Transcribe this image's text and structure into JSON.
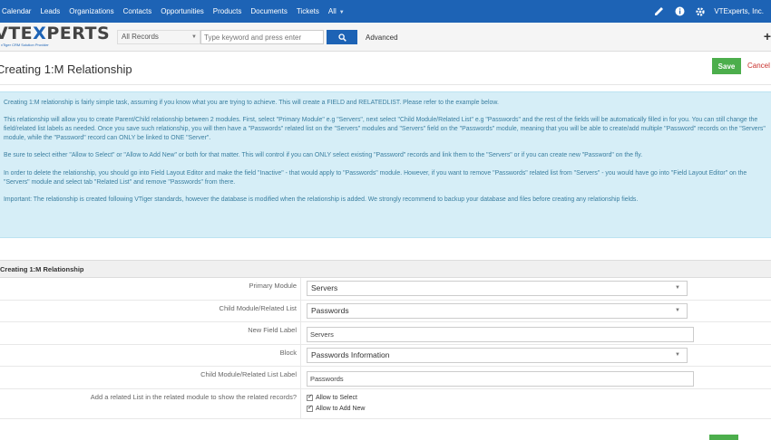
{
  "nav": {
    "tabs": [
      "Calendar",
      "Leads",
      "Organizations",
      "Contacts",
      "Opportunities",
      "Products",
      "Documents",
      "Tickets",
      "All"
    ],
    "company": "VTExperts, Inc."
  },
  "search": {
    "logo_main_1": "VTE",
    "logo_main_2": "X",
    "logo_main_3": "PERTS",
    "logo_tagline": "vTiger CRM Solution Provider",
    "records_label": "All Records",
    "placeholder": "Type keyword and press enter",
    "advanced_label": "Advanced"
  },
  "header": {
    "title": "Creating 1:M Relationship",
    "save_label": "Save",
    "cancel_label": "Cancel"
  },
  "info": {
    "p1": "Creating 1:M relationship is fairly simple task, assuming if you know what you are trying to achieve. This will create a FIELD and RELATEDLIST. Please refer to the example below.",
    "p2": "This relationship will allow you to create Parent/Child relationship between 2 modules. First, select \"Primary Module\" e.g \"Servers\", next select \"Child Module/Related List\" e.g \"Passwords\" and the rest of the fields will be automatically filled in for you. You can still change the field/related list labels as needed. Once you save such relationship, you will then have a \"Passwords\" related list on the \"Servers\" modules and \"Servers\" field on the \"Passwords\" module, meaning that you will be able to create/add multiple \"Password\" records on the \"Servers\" module, while the \"Password\" record can ONLY be linked to ONE \"Server\".",
    "p3": "Be sure to select either \"Allow to Select\" or \"Allow to Add New\" or both for that matter. This will control if you can ONLY select existing \"Password\" records and link them to the \"Servers\" or if you can create new \"Password\" on the fly.",
    "p4": "In order to delete the relationship, you should go into Field Layout Editor and make the field \"Inactive\" - that would apply to \"Passwords\" module. However, if you want to remove \"Passwords\" related list from \"Servers\" - you would have go into \"Field Layout Editor\" on the \"Servers\" module and select tab \"Related List\" and remove \"Passwords\" from there.",
    "p5": "Important: The relationship is created following VTiger standards, however the database is modified when the relationship is added. We strongly recommend to backup your database and files before creating any relationship fields."
  },
  "form": {
    "block_title": "Creating 1:M Relationship",
    "primary_module_label": "Primary Module",
    "primary_module_value": "Servers",
    "child_module_label": "Child Module/Related List",
    "child_module_value": "Passwords",
    "field_label_label": "New Field Label",
    "field_label_value": "Servers",
    "block_label": "Block",
    "block_value": "Passwords Information",
    "related_list_label_label": "Child Module/Related List Label",
    "related_list_label_value": "Passwords",
    "related_list_question": "Add a related List in the related module to show the related records?",
    "allow_select_label": "Allow to Select",
    "allow_add_label": "Allow to Add New"
  }
}
